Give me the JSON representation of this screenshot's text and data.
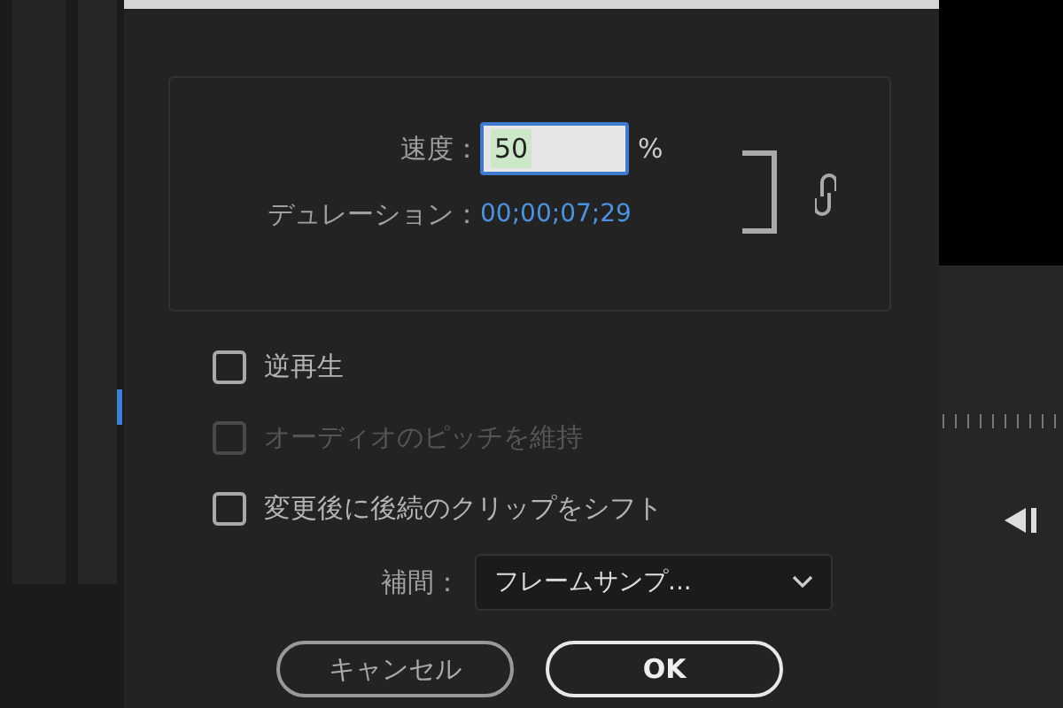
{
  "dialog": {
    "speed": {
      "label": "速度：",
      "value": "50",
      "unit": "%"
    },
    "duration": {
      "label": "デュレーション：",
      "value": "00;00;07;29"
    },
    "options": [
      {
        "label": "逆再生",
        "checked": false,
        "disabled": false
      },
      {
        "label": "オーディオのピッチを維持",
        "checked": false,
        "disabled": true
      },
      {
        "label": "変更後に後続のクリップをシフト",
        "checked": false,
        "disabled": false
      }
    ],
    "interpolation": {
      "label": "補間：",
      "value": "フレームサンプ..."
    },
    "buttons": [
      {
        "label": "キャンセル",
        "default": false
      },
      {
        "label": "OK",
        "default": true
      }
    ]
  }
}
